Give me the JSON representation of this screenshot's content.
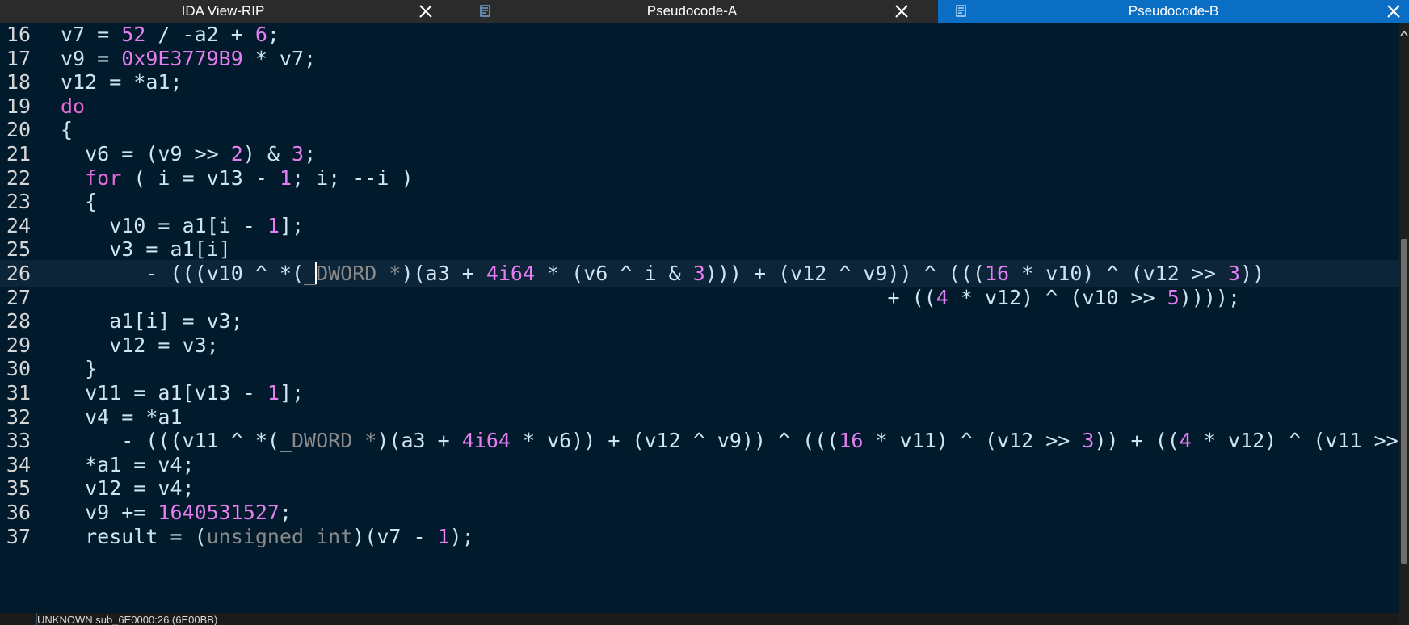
{
  "tabs": [
    {
      "label": "IDA View-RIP",
      "active": false
    },
    {
      "label": "Pseudocode-A",
      "active": false
    },
    {
      "label": "Pseudocode-B",
      "active": true
    }
  ],
  "colors": {
    "background": "#011a2c",
    "keyword": "#e56ad8",
    "number": "#e57ef0",
    "cast": "#8a8a8a",
    "active_tab": "#0a6ec5"
  },
  "lines": [
    {
      "n": "16",
      "t": "v7 = 52 / -a2 + 6;"
    },
    {
      "n": "17",
      "t": "v9 = 0x9E3779B9 * v7;"
    },
    {
      "n": "18",
      "t": "v12 = *a1;"
    },
    {
      "n": "19",
      "t": "do"
    },
    {
      "n": "20",
      "t": "{"
    },
    {
      "n": "21",
      "t": "  v6 = (v9 >> 2) & 3;"
    },
    {
      "n": "22",
      "t": "  for ( i = v13 - 1; i; --i )"
    },
    {
      "n": "23",
      "t": "  {"
    },
    {
      "n": "24",
      "t": "    v10 = a1[i - 1];"
    },
    {
      "n": "25",
      "t": "    v3 = a1[i]"
    },
    {
      "n": "26",
      "t": "       - (((v10 ^ *(_DWORD *)(a3 + 4i64 * (v6 ^ i & 3))) + (v12 ^ v9)) ^ (((16 * v10) ^ (v12 >> 3))"
    },
    {
      "n": "27",
      "t": "                                                                    + ((4 * v12) ^ (v10 >> 5))));"
    },
    {
      "n": "28",
      "t": "    a1[i] = v3;"
    },
    {
      "n": "29",
      "t": "    v12 = v3;"
    },
    {
      "n": "30",
      "t": "  }"
    },
    {
      "n": "31",
      "t": "  v11 = a1[v13 - 1];"
    },
    {
      "n": "32",
      "t": "  v4 = *a1"
    },
    {
      "n": "33",
      "t": "     - (((v11 ^ *(_DWORD *)(a3 + 4i64 * v6)) + (v12 ^ v9)) ^ (((16 * v11) ^ (v12 >> 3)) + ((4 * v12) ^ (v11 >>"
    },
    {
      "n": "34",
      "t": "  *a1 = v4;"
    },
    {
      "n": "35",
      "t": "  v12 = v4;"
    },
    {
      "n": "36",
      "t": "  v9 += 1640531527;"
    },
    {
      "n": "37",
      "t": "  result = (unsigned int)(v7 - 1);"
    }
  ],
  "status": {
    "text": "UNKNOWN sub_6E0000:26 (6E00BB)"
  }
}
